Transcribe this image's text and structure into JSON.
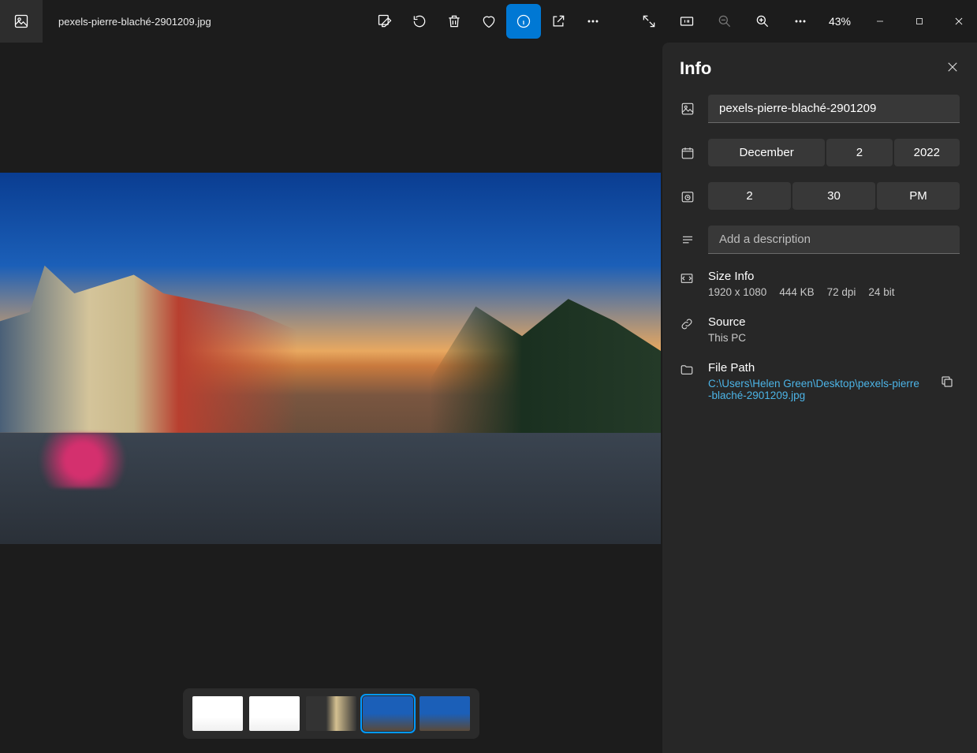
{
  "filename": "pexels-pierre-blaché-2901209.jpg",
  "zoom": "43%",
  "info_panel": {
    "title": "Info",
    "name_value": "pexels-pierre-blaché-2901209",
    "date": {
      "month": "December",
      "day": "2",
      "year": "2022"
    },
    "time": {
      "hour": "2",
      "minute": "30",
      "ampm": "PM"
    },
    "description_placeholder": "Add a description",
    "size_info_label": "Size Info",
    "dimensions": "1920 x 1080",
    "file_size": "444 KB",
    "dpi": "72 dpi",
    "bit_depth": "24 bit",
    "source_label": "Source",
    "source_value": "This PC",
    "file_path_label": "File Path",
    "file_path_value": "C:\\Users\\Helen Green\\Desktop\\pexels-pierre-blaché-2901209.jpg"
  }
}
